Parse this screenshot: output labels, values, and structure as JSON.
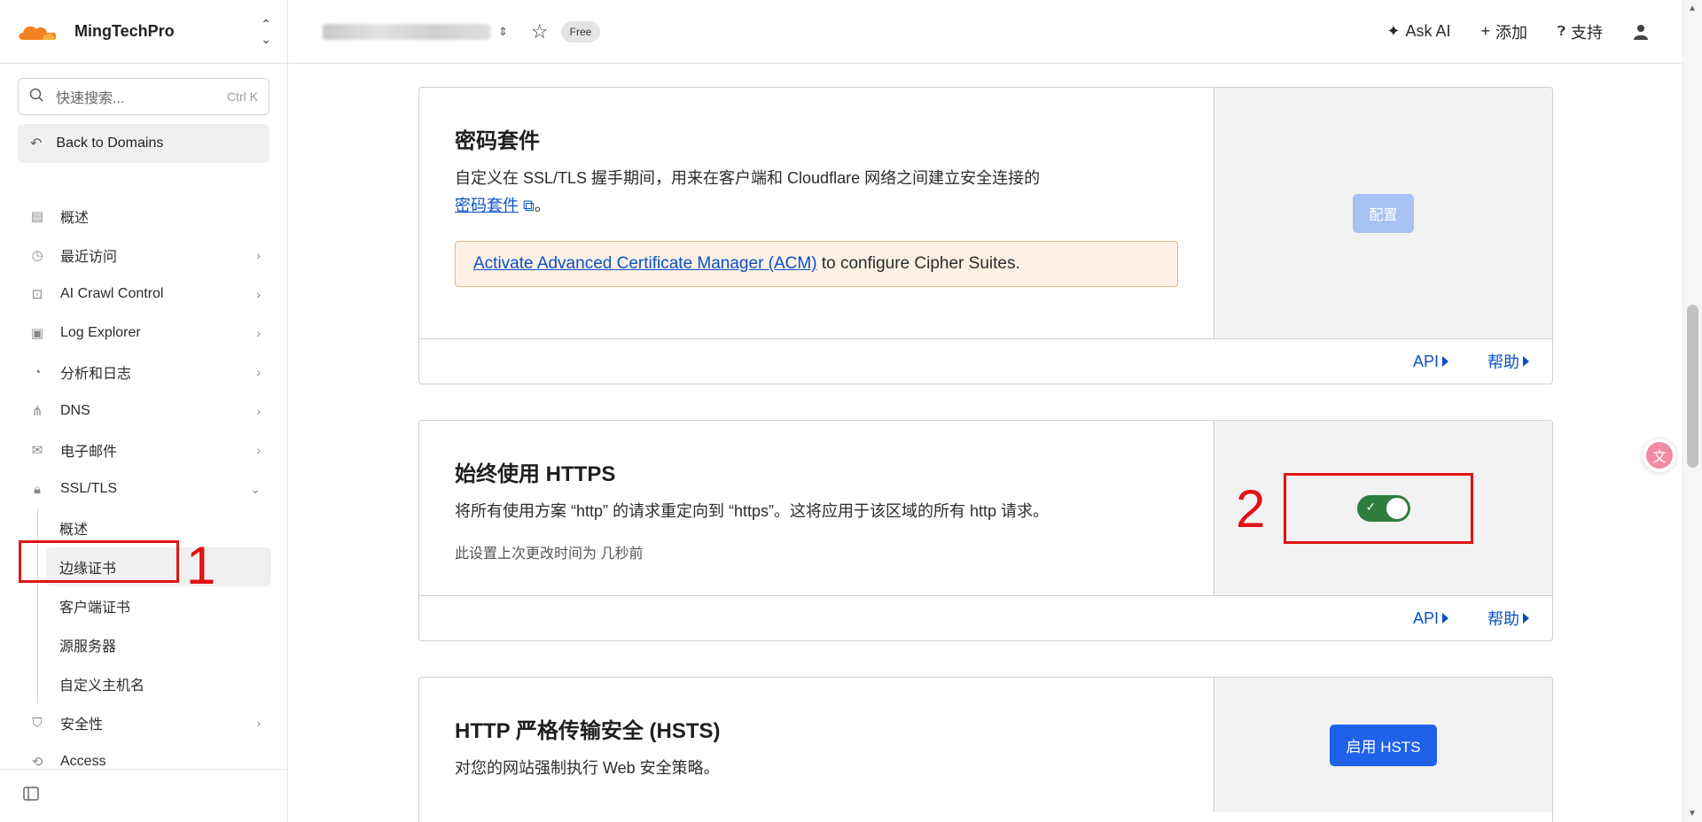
{
  "brand": {
    "account_name": "MingTechPro"
  },
  "search": {
    "placeholder": "快速搜索...",
    "shortcut": "Ctrl K"
  },
  "back": {
    "label": "Back to Domains"
  },
  "sidebar": {
    "items": [
      {
        "label": "概述",
        "icon": "overview-icon"
      },
      {
        "label": "最近访问",
        "icon": "history-icon"
      },
      {
        "label": "AI Crawl Control",
        "icon": "robot-icon"
      },
      {
        "label": "Log Explorer",
        "icon": "log-icon"
      },
      {
        "label": "分析和日志",
        "icon": "analytics-icon"
      },
      {
        "label": "DNS",
        "icon": "dns-icon"
      },
      {
        "label": "电子邮件",
        "icon": "email-icon"
      },
      {
        "label": "SSL/TLS",
        "icon": "lock-icon"
      }
    ],
    "ssl_sub": [
      "概述",
      "边缘证书",
      "客户端证书",
      "源服务器",
      "自定义主机名"
    ],
    "after": [
      {
        "label": "安全性",
        "icon": "shield-icon"
      },
      {
        "label": "Access",
        "icon": "access-icon"
      }
    ]
  },
  "topbar": {
    "plan_badge": "Free",
    "ask_ai": "Ask AI",
    "add": "添加",
    "support": "支持"
  },
  "cards": {
    "cipher": {
      "title": "密码套件",
      "desc": "自定义在 SSL/TLS 握手期间，用来在客户端和 Cloudflare 网络之间建立安全连接的",
      "desc_link": "密码套件",
      "desc_end": "。",
      "notice_link": "Activate Advanced Certificate Manager (ACM)",
      "notice_text": " to configure Cipher Suites.",
      "button": "配置",
      "api": "API",
      "help": "帮助"
    },
    "https": {
      "title": "始终使用 HTTPS",
      "desc": "将所有使用方案 “http” 的请求重定向到 “https”。这将应用于该区域的所有 http 请求。",
      "meta": "此设置上次更改时间为 几秒前",
      "toggle_on": true,
      "api": "API",
      "help": "帮助"
    },
    "hsts": {
      "title": "HTTP 严格传输安全 (HSTS)",
      "desc": "对您的网站强制执行 Web 安全策略。",
      "button": "启用 HSTS"
    }
  },
  "annotations": {
    "one": "1",
    "two": "2"
  },
  "colors": {
    "accent": "#1f62ea",
    "toggle_on": "#2f7d3f",
    "annotation": "#e01414",
    "link": "#0b51c5"
  }
}
